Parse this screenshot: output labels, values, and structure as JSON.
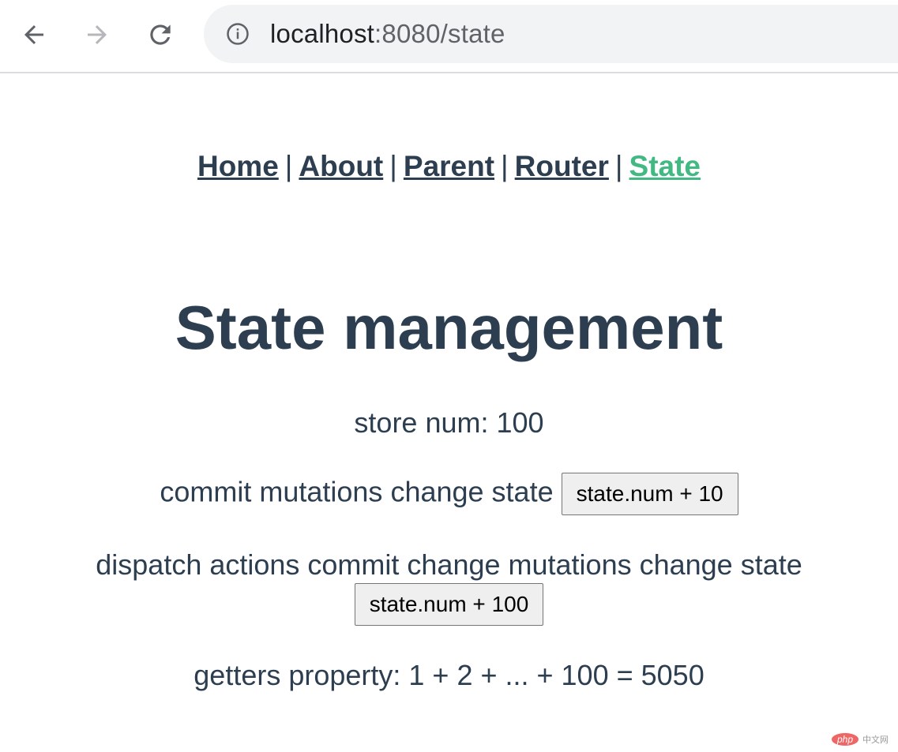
{
  "browser": {
    "url_host": "localhost",
    "url_rest": ":8080/state",
    "icons": [
      "back-arrow-icon",
      "forward-arrow-icon",
      "reload-icon",
      "info-icon"
    ]
  },
  "nav": {
    "links": [
      {
        "label": "Home"
      },
      {
        "label": "About"
      },
      {
        "label": "Parent"
      },
      {
        "label": "Router"
      },
      {
        "label": "State",
        "active": true
      }
    ],
    "separator": "|",
    "active_color": "#42b983",
    "text_color": "#2c3e50"
  },
  "page": {
    "title": "State management",
    "store_num": "store num: 100",
    "mutation_text": "commit mutations change state",
    "mutation_button": "state.num + 10",
    "action_text": "dispatch actions commit change mutations change state",
    "action_button": "state.num + 100",
    "getters_text": "getters property: 1 + 2 + ... + 100 = 5050"
  },
  "watermark": {
    "logo": "php",
    "text": "中文网"
  }
}
